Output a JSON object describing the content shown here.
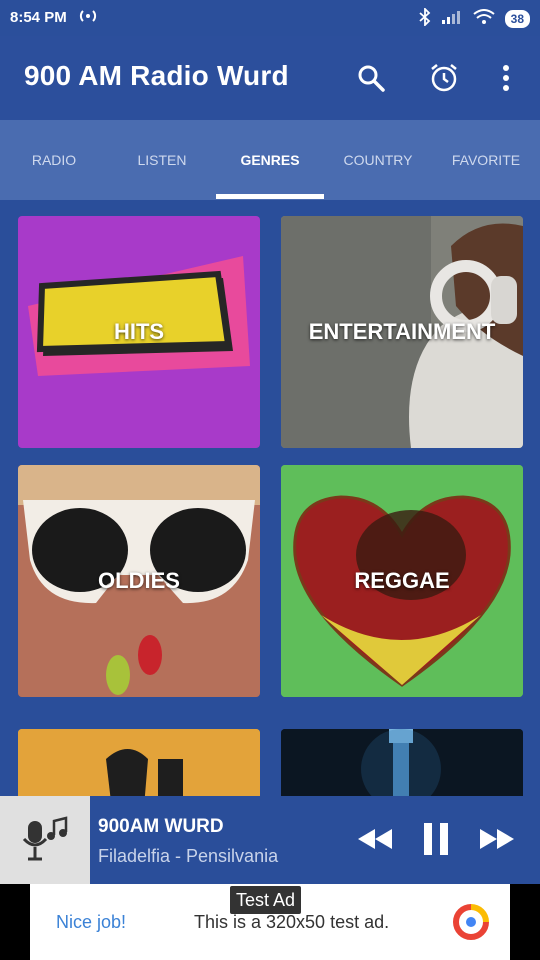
{
  "status_bar": {
    "time": "8:54 PM",
    "battery": "38"
  },
  "app_bar": {
    "title": "900 AM Radio Wurd",
    "icons": [
      "search-icon",
      "alarm-icon",
      "more-vert-icon"
    ]
  },
  "tabs": [
    {
      "label": "RADIO",
      "active": false
    },
    {
      "label": "LISTEN",
      "active": false
    },
    {
      "label": "GENRES",
      "active": true
    },
    {
      "label": "COUNTRY",
      "active": false
    },
    {
      "label": "FAVORITE",
      "active": false
    }
  ],
  "genres": [
    {
      "label": "HITS",
      "color": "#a83ac9"
    },
    {
      "label": "ENTERTAINMENT",
      "color": "#8a8a88"
    },
    {
      "label": "OLDIES",
      "color": "#a0584a"
    },
    {
      "label": "REGGAE",
      "color": "#5fbe5a"
    },
    {
      "label": "",
      "color": "#e3a33a"
    },
    {
      "label": "",
      "color": "#0e1a2a"
    }
  ],
  "player": {
    "station_name": "900AM WURD",
    "location": "Filadelfia - Pensilvania",
    "icons": [
      "mic-music-icon",
      "rewind-icon",
      "pause-icon",
      "fast-forward-icon"
    ]
  },
  "ad": {
    "tag": "Test Ad",
    "nice": "Nice job!",
    "text": "This is a 320x50 test ad."
  },
  "colors": {
    "primary": "#2c4f9c",
    "tab_bar": "#4a6cb0",
    "ad_link": "#3b82d6"
  }
}
